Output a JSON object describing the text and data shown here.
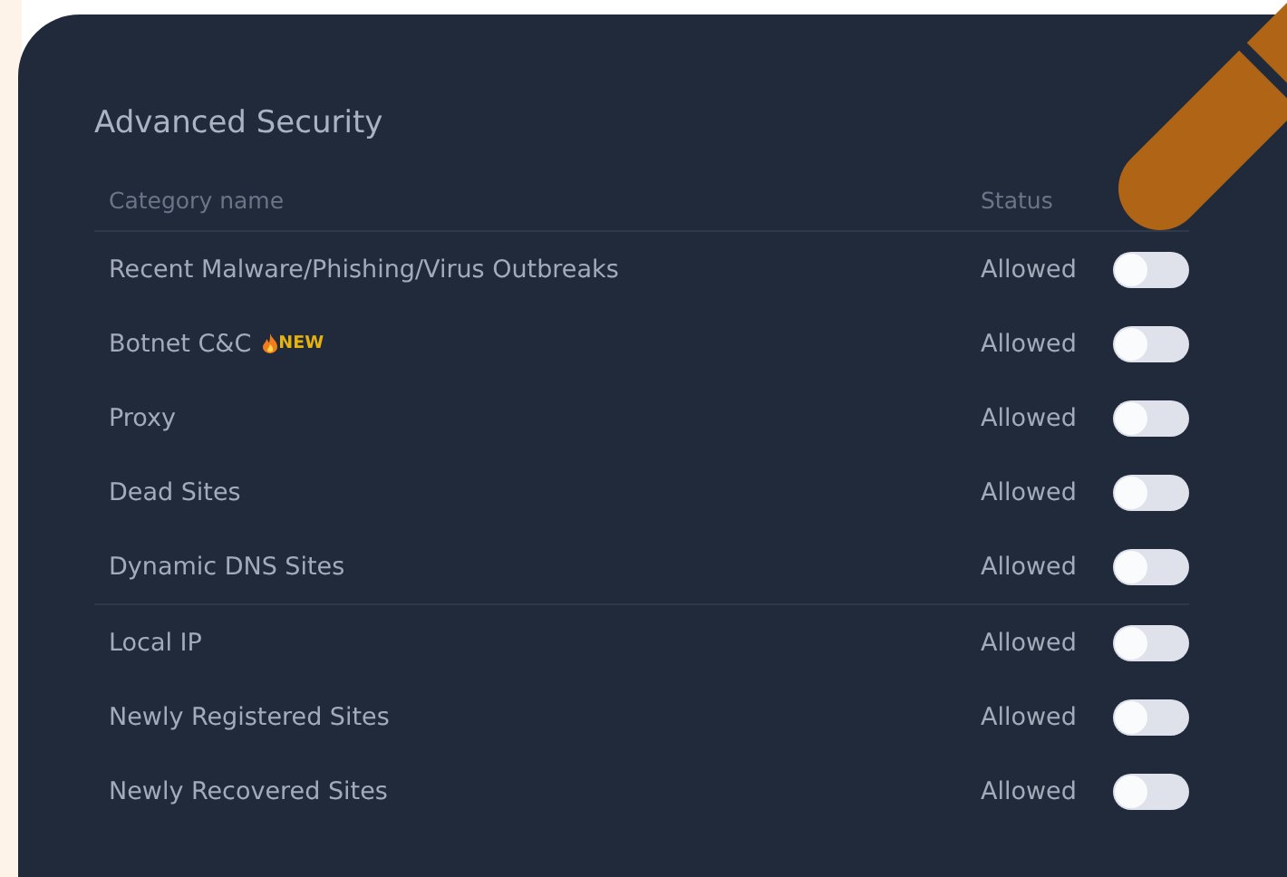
{
  "panel": {
    "title": "Advanced Security"
  },
  "table": {
    "columns": [
      "Category name",
      "Status"
    ],
    "row_groups": [
      {
        "rows": [
          {
            "name": "Recent Malware/Phishing/Virus Outbreaks",
            "status": "Allowed",
            "on": false
          },
          {
            "name": "Botnet C&C",
            "badge": "NEW",
            "status": "Allowed",
            "on": false
          },
          {
            "name": "Proxy",
            "status": "Allowed",
            "on": false
          },
          {
            "name": "Dead Sites",
            "status": "Allowed",
            "on": false
          },
          {
            "name": "Dynamic DNS Sites",
            "status": "Allowed",
            "on": false
          }
        ]
      },
      {
        "rows": [
          {
            "name": "Local IP",
            "status": "Allowed",
            "on": false
          },
          {
            "name": "Newly Registered Sites",
            "status": "Allowed",
            "on": false
          },
          {
            "name": "Newly Recovered Sites",
            "status": "Allowed",
            "on": false
          }
        ]
      }
    ]
  }
}
